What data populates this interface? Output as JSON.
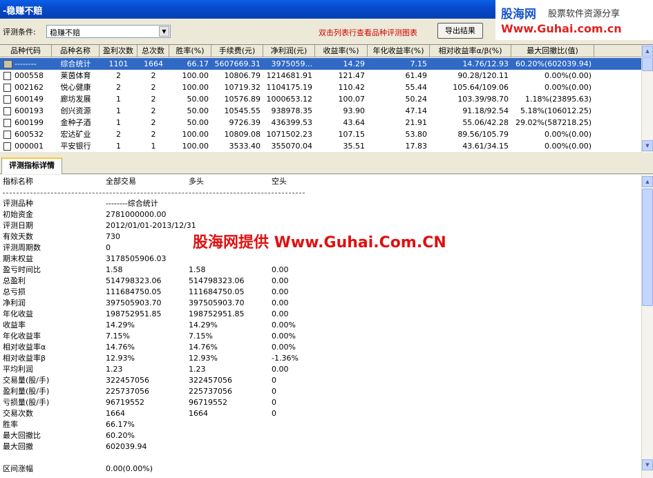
{
  "window": {
    "title": "-稳赚不赔"
  },
  "brand": {
    "name": "股海网",
    "tagline": "股票软件资源分享",
    "url": "Www.Guhai.com.cn"
  },
  "toolbar": {
    "condition_label": "评测条件:",
    "condition_value": "稳赚不赔",
    "hint": "双击列表行查看品种评测图表",
    "export_label": "导出结果"
  },
  "table": {
    "columns": [
      "品种代码",
      "品种名称",
      "盈利次数",
      "总次数",
      "胜率(%)",
      "手续费(元)",
      "净利润(元)",
      "收益率(%)",
      "年化收益率(%)",
      "相对收益率α/β(%)",
      "最大回撤比(值)"
    ],
    "rows": [
      [
        "--------",
        "综合统计",
        "1101",
        "1664",
        "66.17",
        "5607669.31",
        "3975059...",
        "14.29",
        "7.15",
        "14.76/12.93",
        "60.20%(602039.94)"
      ],
      [
        "000558",
        "莱茵体育",
        "2",
        "2",
        "100.00",
        "10806.79",
        "1214681.91",
        "121.47",
        "61.49",
        "90.28/120.11",
        "0.00%(0.00)"
      ],
      [
        "002162",
        "悦心健康",
        "2",
        "2",
        "100.00",
        "10719.32",
        "1104175.19",
        "110.42",
        "55.44",
        "105.64/109.06",
        "0.00%(0.00)"
      ],
      [
        "600149",
        "廊坊发展",
        "1",
        "2",
        "50.00",
        "10576.89",
        "1000653.12",
        "100.07",
        "50.24",
        "103.39/98.70",
        "1.18%(23895.63)"
      ],
      [
        "600193",
        "创兴资源",
        "1",
        "2",
        "50.00",
        "10545.55",
        "938978.35",
        "93.90",
        "47.14",
        "91.18/92.54",
        "5.18%(106012.25)"
      ],
      [
        "600199",
        "金种子酒",
        "1",
        "2",
        "50.00",
        "9726.39",
        "436399.53",
        "43.64",
        "21.91",
        "55.06/42.28",
        "29.02%(587218.25)"
      ],
      [
        "600532",
        "宏达矿业",
        "2",
        "2",
        "100.00",
        "10809.08",
        "1071502.23",
        "107.15",
        "53.80",
        "89.56/105.79",
        "0.00%(0.00)"
      ],
      [
        "000001",
        "平安银行",
        "1",
        "1",
        "100.00",
        "3533.40",
        "355070.04",
        "35.51",
        "17.83",
        "43.61/34.15",
        "0.00%(0.00)"
      ]
    ]
  },
  "tab": {
    "label": "评测指标详情"
  },
  "detail": {
    "header": [
      "指标名称",
      "全部交易",
      "多头",
      "空头"
    ],
    "separator": "------------------------------------------------------------------------------",
    "rows": [
      [
        "评测品种",
        "--------综合统计",
        "",
        ""
      ],
      [
        "初始资金",
        "2781000000.00",
        "",
        ""
      ],
      [
        "评测日期",
        "2012/01/01-2013/12/31",
        "",
        ""
      ],
      [
        "有效天数",
        "730",
        "",
        ""
      ],
      [
        "评测周期数",
        "0",
        "",
        ""
      ],
      [
        "期末权益",
        "3178505906.03",
        "",
        ""
      ],
      [
        "盈亏时间比",
        "1.58",
        "1.58",
        "0.00"
      ],
      [
        "总盈利",
        "514798323.06",
        "514798323.06",
        "0.00"
      ],
      [
        "总亏损",
        "111684750.05",
        "111684750.05",
        "0.00"
      ],
      [
        "净利润",
        "397505903.70",
        "397505903.70",
        "0.00"
      ],
      [
        "年化收益",
        "198752951.85",
        "198752951.85",
        "0.00"
      ],
      [
        "收益率",
        "14.29%",
        "14.29%",
        "0.00%"
      ],
      [
        "年化收益率",
        "7.15%",
        "7.15%",
        "0.00%"
      ],
      [
        "相对收益率α",
        "14.76%",
        " 14.76%",
        " 0.00%"
      ],
      [
        "相对收益率β",
        "12.93%",
        " 12.93%",
        " -1.36%"
      ],
      [
        "平均利润",
        "1.23",
        "1.23",
        "0.00"
      ],
      [
        "交易量(股/手)",
        "322457056",
        "322457056",
        "0"
      ],
      [
        "盈利量(股/手)",
        "225737056",
        "225737056",
        "0"
      ],
      [
        "亏损量(股/手)",
        "96719552",
        "96719552",
        "0"
      ],
      [
        "交易次数",
        "1664",
        "1664",
        "0"
      ],
      [
        "胜率",
        "66.17%",
        "",
        ""
      ],
      [
        "最大回撤比",
        "60.20%",
        "",
        ""
      ],
      [
        "最大回撤",
        "602039.94",
        "",
        ""
      ],
      [
        "",
        "",
        "",
        ""
      ],
      [
        "区间涨幅",
        "0.00(0.00%)",
        "",
        ""
      ]
    ],
    "watermark": "股海网提供 Www.Guhai.Com.CN"
  }
}
